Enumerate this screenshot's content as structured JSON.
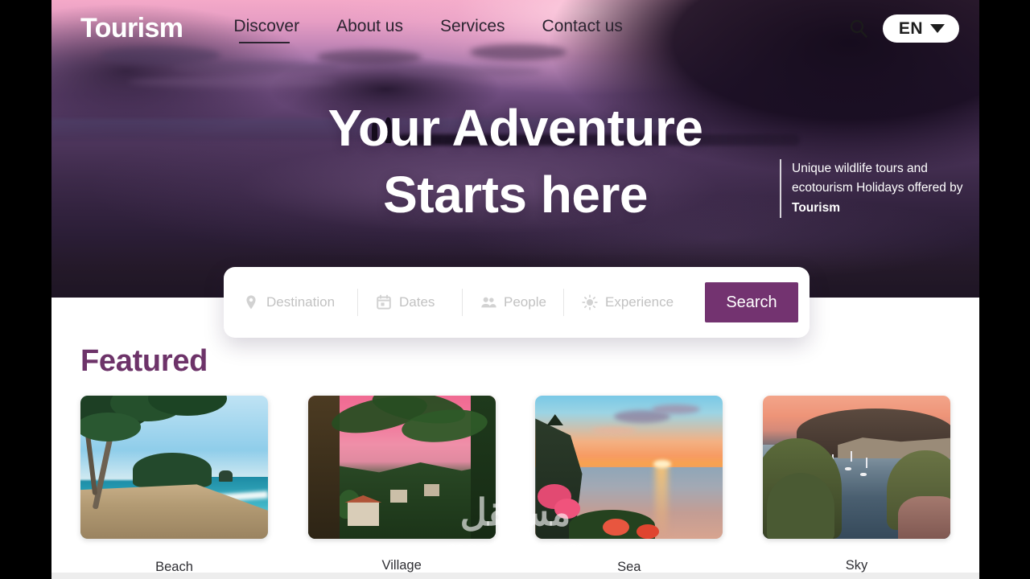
{
  "brand": {
    "logo": "Tourism",
    "accent_purple": "#6d3369",
    "button_purple": "#733370"
  },
  "nav": {
    "links": [
      {
        "label": "Discover",
        "active": true
      },
      {
        "label": "About us",
        "active": false
      },
      {
        "label": "Services",
        "active": false
      },
      {
        "label": "Contact us",
        "active": false
      }
    ],
    "search_icon": "search-icon",
    "language": {
      "value": "EN",
      "caret": "chevron-down-icon"
    }
  },
  "hero": {
    "title_line1": "Your Adventure",
    "title_line2": "Starts here",
    "tagline_part1": "Unique wildlife tours and ecotourism Holidays offered by ",
    "tagline_brand": "Tourism"
  },
  "search_panel": {
    "fields": [
      {
        "icon": "map-pin-icon",
        "placeholder": "Destination"
      },
      {
        "icon": "calendar-icon",
        "placeholder": "Dates"
      },
      {
        "icon": "people-icon",
        "placeholder": "People"
      },
      {
        "icon": "sun-icon",
        "placeholder": "Experience"
      }
    ],
    "submit_label": "Search"
  },
  "featured": {
    "heading": "Featured",
    "cards": [
      {
        "label": "Beach"
      },
      {
        "label": "Village"
      },
      {
        "label": "Sea"
      },
      {
        "label": "Sky"
      }
    ]
  },
  "watermark": {
    "arabic": "مستقل",
    "url": "mostaql.com"
  }
}
